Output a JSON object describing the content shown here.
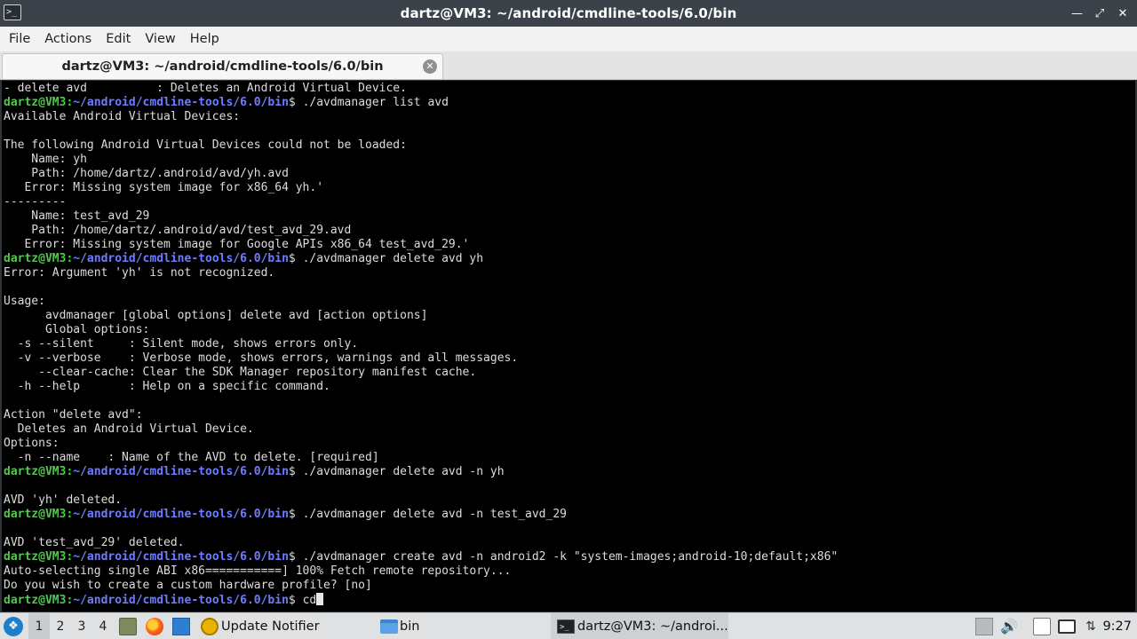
{
  "window": {
    "title": "dartz@VM3: ~/android/cmdline-tools/6.0/bin",
    "controls": [
      "—",
      "⤢",
      "✕"
    ]
  },
  "menu": [
    "File",
    "Actions",
    "Edit",
    "View",
    "Help"
  ],
  "tab": {
    "label": "dartz@VM3: ~/android/cmdline-tools/6.0/bin",
    "close_icon": "close-icon"
  },
  "terminal": {
    "prompt_user": "dartz@VM3",
    "prompt_path": "~/android/cmdline-tools/6.0/bin",
    "lines": [
      {
        "type": "out",
        "text": "- delete avd          : Deletes an Android Virtual Device."
      },
      {
        "type": "cmd",
        "cmd": "./avdmanager list avd"
      },
      {
        "type": "out",
        "text": "Available Android Virtual Devices:"
      },
      {
        "type": "out",
        "text": ""
      },
      {
        "type": "out",
        "text": "The following Android Virtual Devices could not be loaded:"
      },
      {
        "type": "out",
        "text": "    Name: yh"
      },
      {
        "type": "out",
        "text": "    Path: /home/dartz/.android/avd/yh.avd"
      },
      {
        "type": "out",
        "text": "   Error: Missing system image for x86_64 yh.'"
      },
      {
        "type": "out",
        "text": "---------"
      },
      {
        "type": "out",
        "text": "    Name: test_avd_29"
      },
      {
        "type": "out",
        "text": "    Path: /home/dartz/.android/avd/test_avd_29.avd"
      },
      {
        "type": "out",
        "text": "   Error: Missing system image for Google APIs x86_64 test_avd_29.'"
      },
      {
        "type": "cmd",
        "cmd": "./avdmanager delete avd yh"
      },
      {
        "type": "out",
        "text": "Error: Argument 'yh' is not recognized."
      },
      {
        "type": "out",
        "text": ""
      },
      {
        "type": "out",
        "text": "Usage:"
      },
      {
        "type": "out",
        "text": "      avdmanager [global options] delete avd [action options]"
      },
      {
        "type": "out",
        "text": "      Global options:"
      },
      {
        "type": "out",
        "text": "  -s --silent     : Silent mode, shows errors only."
      },
      {
        "type": "out",
        "text": "  -v --verbose    : Verbose mode, shows errors, warnings and all messages."
      },
      {
        "type": "out",
        "text": "     --clear-cache: Clear the SDK Manager repository manifest cache."
      },
      {
        "type": "out",
        "text": "  -h --help       : Help on a specific command."
      },
      {
        "type": "out",
        "text": ""
      },
      {
        "type": "out",
        "text": "Action \"delete avd\":"
      },
      {
        "type": "out",
        "text": "  Deletes an Android Virtual Device."
      },
      {
        "type": "out",
        "text": "Options:"
      },
      {
        "type": "out",
        "text": "  -n --name    : Name of the AVD to delete. [required]"
      },
      {
        "type": "cmd",
        "cmd": "./avdmanager delete avd -n yh"
      },
      {
        "type": "out",
        "text": ""
      },
      {
        "type": "out",
        "text": "AVD 'yh' deleted."
      },
      {
        "type": "cmd",
        "cmd": "./avdmanager delete avd -n test_avd_29"
      },
      {
        "type": "out",
        "text": ""
      },
      {
        "type": "out",
        "text": "AVD 'test_avd_29' deleted."
      },
      {
        "type": "cmd",
        "cmd": "./avdmanager create avd -n android2 -k \"system-images;android-10;default;x86\""
      },
      {
        "type": "out",
        "text": "Auto-selecting single ABI x86===========] 100% Fetch remote repository..."
      },
      {
        "type": "out",
        "text": "Do you wish to create a custom hardware profile? [no]"
      },
      {
        "type": "cmd",
        "cmd": "cd",
        "cursor": true
      }
    ]
  },
  "taskbar": {
    "workspaces": [
      "1",
      "2",
      "3",
      "4"
    ],
    "active_workspace": "1",
    "launchers": [
      "file-manager-icon",
      "firefox-icon",
      "show-desktop-icon"
    ],
    "tasks": [
      {
        "label": "Update Notifier",
        "icon": "update-notifier-icon"
      },
      {
        "label": "bin",
        "icon": "folder-icon"
      },
      {
        "label": "dartz@VM3: ~/androi...",
        "icon": "terminal-icon",
        "active": true
      }
    ],
    "tray": [
      "battery-icon",
      "volume-icon",
      "clipboard-icon",
      "display-icon",
      "network-icon"
    ],
    "clock": "9:27"
  }
}
